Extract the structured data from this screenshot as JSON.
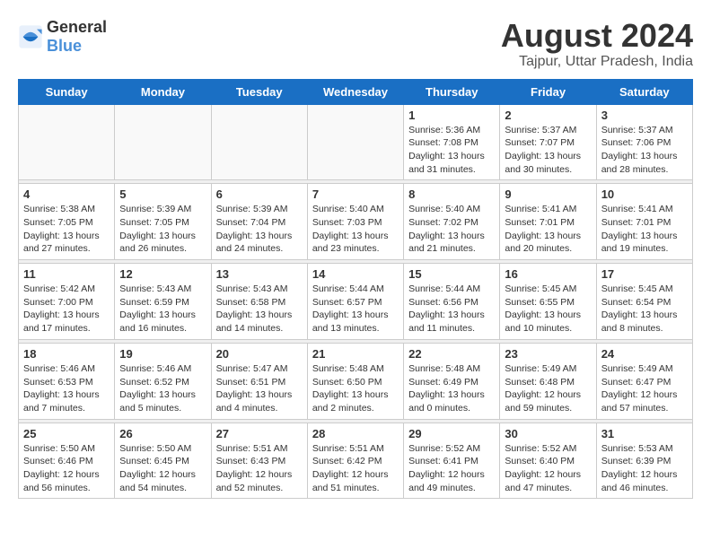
{
  "logo": {
    "general": "General",
    "blue": "Blue"
  },
  "title": {
    "month_year": "August 2024",
    "location": "Tajpur, Uttar Pradesh, India"
  },
  "days_of_week": [
    "Sunday",
    "Monday",
    "Tuesday",
    "Wednesday",
    "Thursday",
    "Friday",
    "Saturday"
  ],
  "weeks": [
    [
      {
        "day": "",
        "info": ""
      },
      {
        "day": "",
        "info": ""
      },
      {
        "day": "",
        "info": ""
      },
      {
        "day": "",
        "info": ""
      },
      {
        "day": "1",
        "info": "Sunrise: 5:36 AM\nSunset: 7:08 PM\nDaylight: 13 hours\nand 31 minutes."
      },
      {
        "day": "2",
        "info": "Sunrise: 5:37 AM\nSunset: 7:07 PM\nDaylight: 13 hours\nand 30 minutes."
      },
      {
        "day": "3",
        "info": "Sunrise: 5:37 AM\nSunset: 7:06 PM\nDaylight: 13 hours\nand 28 minutes."
      }
    ],
    [
      {
        "day": "4",
        "info": "Sunrise: 5:38 AM\nSunset: 7:05 PM\nDaylight: 13 hours\nand 27 minutes."
      },
      {
        "day": "5",
        "info": "Sunrise: 5:39 AM\nSunset: 7:05 PM\nDaylight: 13 hours\nand 26 minutes."
      },
      {
        "day": "6",
        "info": "Sunrise: 5:39 AM\nSunset: 7:04 PM\nDaylight: 13 hours\nand 24 minutes."
      },
      {
        "day": "7",
        "info": "Sunrise: 5:40 AM\nSunset: 7:03 PM\nDaylight: 13 hours\nand 23 minutes."
      },
      {
        "day": "8",
        "info": "Sunrise: 5:40 AM\nSunset: 7:02 PM\nDaylight: 13 hours\nand 21 minutes."
      },
      {
        "day": "9",
        "info": "Sunrise: 5:41 AM\nSunset: 7:01 PM\nDaylight: 13 hours\nand 20 minutes."
      },
      {
        "day": "10",
        "info": "Sunrise: 5:41 AM\nSunset: 7:01 PM\nDaylight: 13 hours\nand 19 minutes."
      }
    ],
    [
      {
        "day": "11",
        "info": "Sunrise: 5:42 AM\nSunset: 7:00 PM\nDaylight: 13 hours\nand 17 minutes."
      },
      {
        "day": "12",
        "info": "Sunrise: 5:43 AM\nSunset: 6:59 PM\nDaylight: 13 hours\nand 16 minutes."
      },
      {
        "day": "13",
        "info": "Sunrise: 5:43 AM\nSunset: 6:58 PM\nDaylight: 13 hours\nand 14 minutes."
      },
      {
        "day": "14",
        "info": "Sunrise: 5:44 AM\nSunset: 6:57 PM\nDaylight: 13 hours\nand 13 minutes."
      },
      {
        "day": "15",
        "info": "Sunrise: 5:44 AM\nSunset: 6:56 PM\nDaylight: 13 hours\nand 11 minutes."
      },
      {
        "day": "16",
        "info": "Sunrise: 5:45 AM\nSunset: 6:55 PM\nDaylight: 13 hours\nand 10 minutes."
      },
      {
        "day": "17",
        "info": "Sunrise: 5:45 AM\nSunset: 6:54 PM\nDaylight: 13 hours\nand 8 minutes."
      }
    ],
    [
      {
        "day": "18",
        "info": "Sunrise: 5:46 AM\nSunset: 6:53 PM\nDaylight: 13 hours\nand 7 minutes."
      },
      {
        "day": "19",
        "info": "Sunrise: 5:46 AM\nSunset: 6:52 PM\nDaylight: 13 hours\nand 5 minutes."
      },
      {
        "day": "20",
        "info": "Sunrise: 5:47 AM\nSunset: 6:51 PM\nDaylight: 13 hours\nand 4 minutes."
      },
      {
        "day": "21",
        "info": "Sunrise: 5:48 AM\nSunset: 6:50 PM\nDaylight: 13 hours\nand 2 minutes."
      },
      {
        "day": "22",
        "info": "Sunrise: 5:48 AM\nSunset: 6:49 PM\nDaylight: 13 hours\nand 0 minutes."
      },
      {
        "day": "23",
        "info": "Sunrise: 5:49 AM\nSunset: 6:48 PM\nDaylight: 12 hours\nand 59 minutes."
      },
      {
        "day": "24",
        "info": "Sunrise: 5:49 AM\nSunset: 6:47 PM\nDaylight: 12 hours\nand 57 minutes."
      }
    ],
    [
      {
        "day": "25",
        "info": "Sunrise: 5:50 AM\nSunset: 6:46 PM\nDaylight: 12 hours\nand 56 minutes."
      },
      {
        "day": "26",
        "info": "Sunrise: 5:50 AM\nSunset: 6:45 PM\nDaylight: 12 hours\nand 54 minutes."
      },
      {
        "day": "27",
        "info": "Sunrise: 5:51 AM\nSunset: 6:43 PM\nDaylight: 12 hours\nand 52 minutes."
      },
      {
        "day": "28",
        "info": "Sunrise: 5:51 AM\nSunset: 6:42 PM\nDaylight: 12 hours\nand 51 minutes."
      },
      {
        "day": "29",
        "info": "Sunrise: 5:52 AM\nSunset: 6:41 PM\nDaylight: 12 hours\nand 49 minutes."
      },
      {
        "day": "30",
        "info": "Sunrise: 5:52 AM\nSunset: 6:40 PM\nDaylight: 12 hours\nand 47 minutes."
      },
      {
        "day": "31",
        "info": "Sunrise: 5:53 AM\nSunset: 6:39 PM\nDaylight: 12 hours\nand 46 minutes."
      }
    ]
  ]
}
